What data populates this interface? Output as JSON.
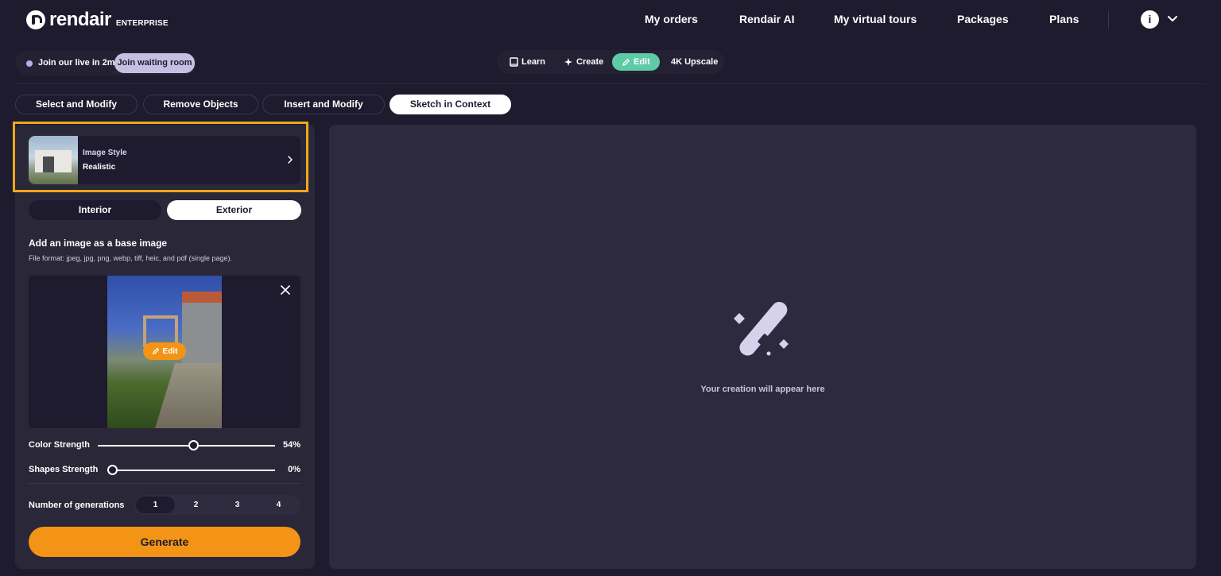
{
  "brand": {
    "name": "rendair",
    "tag": "ENTERPRISE"
  },
  "nav": {
    "items": [
      {
        "id": "orders",
        "label": "My orders"
      },
      {
        "id": "ai",
        "label": "Rendair AI"
      },
      {
        "id": "tours",
        "label": "My virtual tours"
      },
      {
        "id": "packages",
        "label": "Packages"
      },
      {
        "id": "plans",
        "label": "Plans"
      }
    ],
    "avatar_letter": "i"
  },
  "live": {
    "text": "Join our live in 2m",
    "button": "Join waiting room"
  },
  "modes": {
    "learn": "Learn",
    "create": "Create",
    "edit": "Edit",
    "upscale": "4K Upscale",
    "active": "edit"
  },
  "tabs": {
    "select_modify": "Select and Modify",
    "remove_objects": "Remove Objects",
    "insert_modify": "Insert and Modify",
    "sketch_context": "Sketch in Context",
    "active": "sketch_context"
  },
  "style_card": {
    "label": "Image Style",
    "value": "Realistic"
  },
  "segment": {
    "interior": "Interior",
    "exterior": "Exterior",
    "selected": "exterior"
  },
  "base_image": {
    "title": "Add an image as a base image",
    "formats": "File format: jpeg, jpg, png, webp, tiff, heic, and pdf (single page).",
    "edit_label": "Edit"
  },
  "sliders": {
    "color": {
      "label": "Color Strength",
      "value": 54,
      "display": "54%"
    },
    "shapes": {
      "label": "Shapes Strength",
      "value": 0,
      "display": "0%"
    }
  },
  "generations": {
    "label": "Number of generations",
    "options": [
      "1",
      "2",
      "3",
      "4"
    ],
    "selected": "1"
  },
  "generate_label": "Generate",
  "canvas": {
    "message": "Your creation will appear here"
  },
  "colors": {
    "bg": "#1e1b2e",
    "accent_orange": "#f39417",
    "accent_green": "#5fcba6",
    "highlight": "#f0a818"
  }
}
